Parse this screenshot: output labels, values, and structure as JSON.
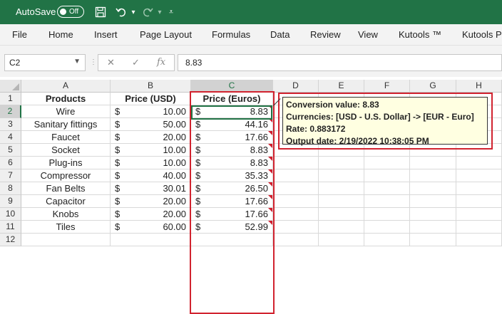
{
  "titlebar": {
    "autosave_label": "AutoSave",
    "toggle_state": "Off"
  },
  "ribbon": {
    "tabs": [
      "File",
      "Home",
      "Insert",
      "Page Layout",
      "Formulas",
      "Data",
      "Review",
      "View",
      "Kutools ™",
      "Kutools Pl"
    ]
  },
  "formulabar": {
    "namebox": "C2",
    "formula": "8.83",
    "fx": "fx"
  },
  "columns": [
    "A",
    "B",
    "C",
    "D",
    "E",
    "F",
    "G",
    "H"
  ],
  "rows": [
    "1",
    "2",
    "3",
    "4",
    "5",
    "6",
    "7",
    "8",
    "9",
    "10",
    "11",
    "12"
  ],
  "headers": {
    "products": "Products",
    "usd": "Price (USD)",
    "euros": "Price (Euros)"
  },
  "currency_symbol": "$",
  "table": [
    {
      "product": "Wire",
      "usd": "10.00",
      "eur": "8.83"
    },
    {
      "product": "Sanitary fittings",
      "usd": "50.00",
      "eur": "44.16"
    },
    {
      "product": "Faucet",
      "usd": "20.00",
      "eur": "17.66"
    },
    {
      "product": "Socket",
      "usd": "10.00",
      "eur": "8.83"
    },
    {
      "product": "Plug-ins",
      "usd": "10.00",
      "eur": "8.83"
    },
    {
      "product": "Compressor",
      "usd": "40.00",
      "eur": "35.33"
    },
    {
      "product": "Fan Belts",
      "usd": "30.01",
      "eur": "26.50"
    },
    {
      "product": "Capacitor",
      "usd": "20.00",
      "eur": "17.66"
    },
    {
      "product": "Knobs",
      "usd": "20.00",
      "eur": "17.66"
    },
    {
      "product": "Tiles",
      "usd": "60.00",
      "eur": "52.99"
    }
  ],
  "comment": {
    "line1": "Conversion value: 8.83",
    "line2": "Currencies: [USD - U.S. Dollar] -> [EUR - Euro]",
    "line3": "Rate: 0.883172",
    "line4": "Output date: 2/19/2022 10:38:05 PM"
  },
  "colors": {
    "excel_green": "#217346",
    "highlight_red": "#d1232f",
    "comment_bg": "#ffffe1"
  }
}
